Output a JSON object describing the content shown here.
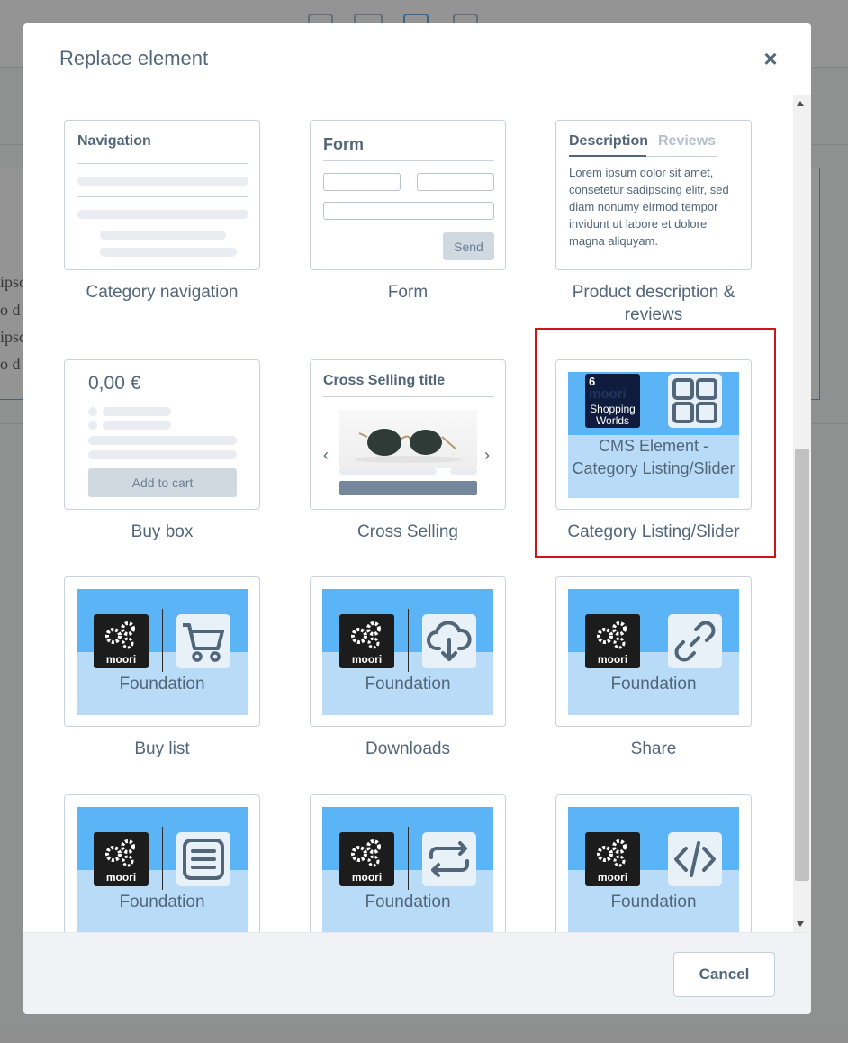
{
  "modal": {
    "title": "Replace element",
    "close_label": "×",
    "cancel_label": "Cancel"
  },
  "background": {
    "text_fragments": [
      "ipsc",
      "o d",
      "ipsc",
      "o d"
    ]
  },
  "elements": {
    "category_navigation": {
      "preview_title": "Navigation",
      "label": "Category navigation"
    },
    "form": {
      "preview_title": "Form",
      "send_label": "Send",
      "label": "Form"
    },
    "product_description": {
      "tab_active": "Description",
      "tab_inactive": "Reviews",
      "text": "Lorem ipsum dolor sit amet, consetetur sadipscing elitr, sed diam nonumy eirmod tempor invidunt ut labore et dolore magna aliquyam.",
      "label": "Product description & reviews"
    },
    "buy_box": {
      "price": "0,00 €",
      "add_to_cart": "Add to cart",
      "label": "Buy box"
    },
    "cross_selling": {
      "preview_title": "Cross Selling title",
      "label": "Cross Selling"
    },
    "category_listing": {
      "logo_number": "6",
      "logo_text_1": "moori",
      "logo_text_2": "Shopping",
      "logo_text_3": "Worlds",
      "tile_text": "CMS Element - Category Listing/Slider",
      "label": "Category Listing/Slider"
    },
    "buy_list": {
      "logo_text": "moori",
      "tile_text": "Foundation",
      "label": "Buy list"
    },
    "downloads": {
      "logo_text": "moori",
      "tile_text": "Foundation",
      "label": "Downloads"
    },
    "share": {
      "logo_text": "moori",
      "tile_text": "Foundation",
      "label": "Share"
    },
    "row4_1": {
      "logo_text": "moori",
      "tile_text": "Foundation"
    },
    "row4_2": {
      "logo_text": "moori",
      "tile_text": "Foundation"
    },
    "row4_3": {
      "logo_text": "moori",
      "tile_text": "Foundation"
    }
  },
  "icons": {
    "buy_list": "cart-icon",
    "downloads": "cloud-download-icon",
    "share": "link-icon",
    "row4_1": "document-list-icon",
    "row4_2": "repeat-icon",
    "row4_3": "code-icon",
    "category_listing": "grid-icon"
  },
  "colors": {
    "tile_top": "#5bb4f5",
    "tile_bottom": "#b8dcf8",
    "highlight": "#d0131a",
    "text": "#52667a"
  }
}
